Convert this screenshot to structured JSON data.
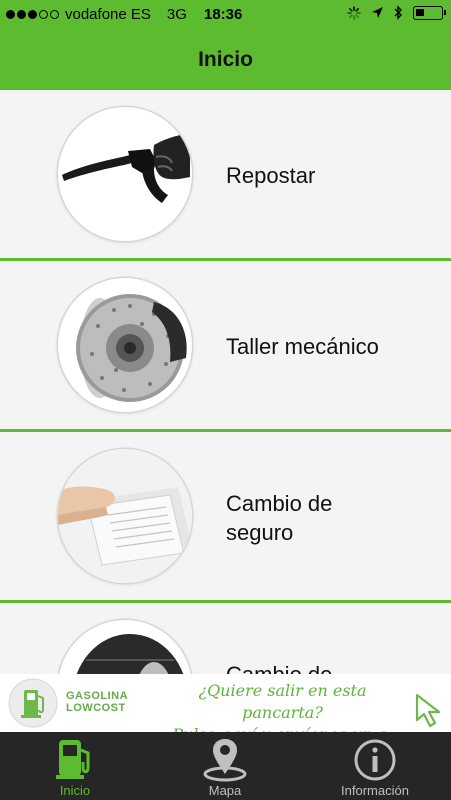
{
  "status_bar": {
    "carrier": "vodafone ES",
    "network": "3G",
    "time": "18:36",
    "signal_bars": 3,
    "signal_total": 5
  },
  "nav": {
    "title": "Inicio"
  },
  "menu": [
    {
      "label_lines": [
        "Repostar"
      ],
      "icon": "fuel-nozzle-icon"
    },
    {
      "label_lines": [
        "Taller mecánico"
      ],
      "icon": "brake-disc-icon"
    },
    {
      "label_lines": [
        "Cambio de",
        "seguro"
      ],
      "icon": "documents-icon"
    },
    {
      "label_lines": [
        "Cambio de"
      ],
      "icon": "tire-icon"
    }
  ],
  "banner": {
    "brand_line1": "GASOLINA",
    "brand_line2": "LOWCOST",
    "message_line1": "¿Quiere salir en esta pancarta?",
    "message_line2": "Pulse aquí y envíenos un e-mail."
  },
  "tabs": [
    {
      "label": "Inicio",
      "icon": "fuel-pump-icon",
      "active": true
    },
    {
      "label": "Mapa",
      "icon": "map-pin-icon",
      "active": false
    },
    {
      "label": "Información",
      "icon": "info-icon",
      "active": false
    }
  ],
  "colors": {
    "accent": "#5cbb2f",
    "tabbar": "#262626",
    "background": "#f4f4f4"
  }
}
